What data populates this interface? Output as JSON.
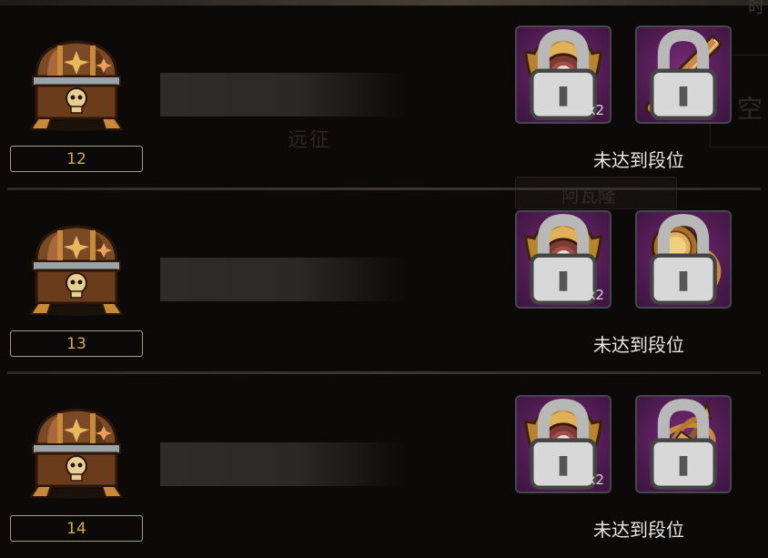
{
  "background": {
    "corner_text": "时",
    "side_text": "空",
    "mid_text": "远征",
    "panel_text": "阿瓦隆"
  },
  "rows": [
    {
      "tier": "12",
      "rewards": [
        {
          "icon": "emblem-badge-icon",
          "qty": "x2",
          "locked": true
        },
        {
          "icon": "sword-icon",
          "qty": "",
          "locked": true
        }
      ],
      "status": "未达到段位"
    },
    {
      "tier": "13",
      "rewards": [
        {
          "icon": "emblem-badge-icon",
          "qty": "x2",
          "locked": true
        },
        {
          "icon": "ring-icon",
          "qty": "",
          "locked": true
        }
      ],
      "status": "未达到段位"
    },
    {
      "tier": "14",
      "rewards": [
        {
          "icon": "emblem-badge-icon",
          "qty": "x2",
          "locked": true
        },
        {
          "icon": "armillary-icon",
          "qty": "",
          "locked": true
        }
      ],
      "status": "未达到段位"
    }
  ],
  "colors": {
    "tier_text": "#d6a84c",
    "reward_bg": "#5a1f5c",
    "status_text": "#e8e6e2"
  }
}
